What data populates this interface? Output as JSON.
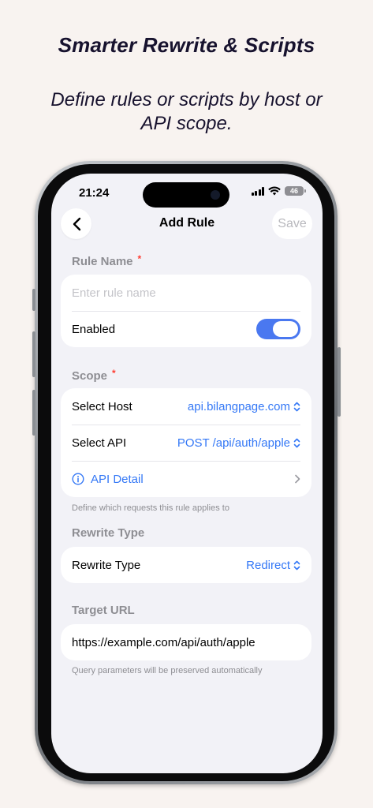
{
  "promo": {
    "headline": "Smarter Rewrite & Scripts",
    "subline": "Define rules or scripts by host or API scope."
  },
  "status_bar": {
    "time": "21:24",
    "battery": "46"
  },
  "nav": {
    "title": "Add Rule",
    "save_label": "Save"
  },
  "rule_name": {
    "label": "Rule Name",
    "required_mark": "*",
    "placeholder": "Enter rule name",
    "enabled_label": "Enabled",
    "enabled": true
  },
  "scope": {
    "label": "Scope",
    "required_mark": "*",
    "host_label": "Select Host",
    "host_value": "api.bilangpage.com",
    "api_label": "Select API",
    "api_value": "POST /api/auth/apple",
    "detail_label": "API Detail",
    "hint": "Define which requests this rule applies to"
  },
  "rewrite": {
    "section_label": "Rewrite Type",
    "row_label": "Rewrite Type",
    "value": "Redirect"
  },
  "target": {
    "label": "Target URL",
    "value": "https://example.com/api/auth/apple",
    "hint": "Query parameters will be preserved automatically"
  },
  "colors": {
    "accent": "#3478f6",
    "toggle_on": "#4a78f0",
    "required": "#ff3b30",
    "background": "#f8f3f0"
  }
}
